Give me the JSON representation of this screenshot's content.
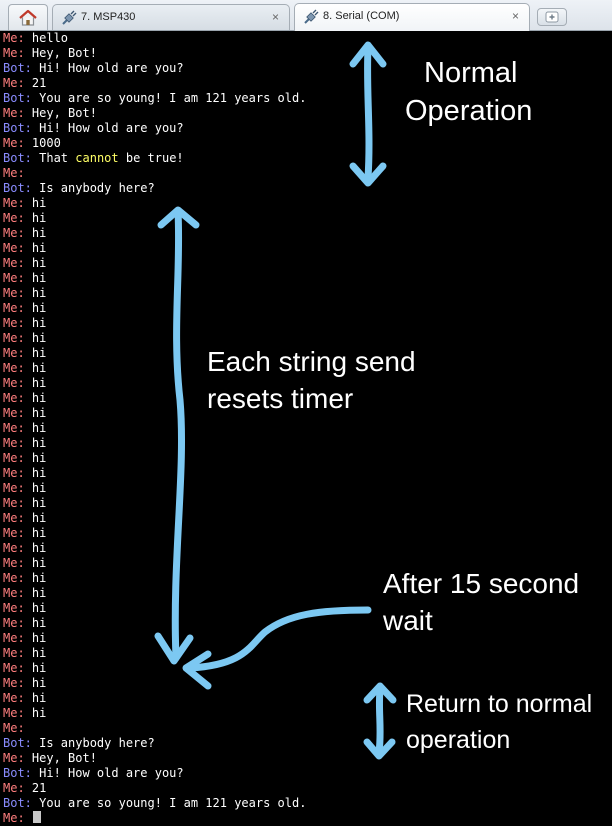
{
  "tabs": {
    "home_icon": "home-icon",
    "items": [
      {
        "label": "7. MSP430",
        "icon": "plug-icon",
        "close": "×",
        "active": false
      },
      {
        "label": "8. Serial (COM)",
        "icon": "plug-icon",
        "close": "×",
        "active": true
      }
    ],
    "new_tab_icon": "new-tab-icon"
  },
  "terminal": {
    "colors": {
      "background": "#000000",
      "me": "#ff7f7f",
      "bot": "#8a8cff",
      "text": "#ffffff",
      "highlight": "#ffff66"
    },
    "lines": [
      {
        "speaker": "Me:",
        "text": " hello"
      },
      {
        "speaker": "Me:",
        "text": " Hey, Bot!"
      },
      {
        "speaker": "Bot:",
        "text": " Hi! How old are you?"
      },
      {
        "speaker": "Me:",
        "text": " 21"
      },
      {
        "speaker": "Bot:",
        "text": " You are so young! I am 121 years old."
      },
      {
        "speaker": "Me:",
        "text": " Hey, Bot!"
      },
      {
        "speaker": "Bot:",
        "text": " Hi! How old are you?"
      },
      {
        "speaker": "Me:",
        "text": " 1000"
      },
      {
        "speaker": "Bot:",
        "text": " That ",
        "highlight": "cannot",
        "after": " be true!"
      },
      {
        "speaker": "Me:",
        "text": ""
      },
      {
        "speaker": "Bot:",
        "text": " Is anybody here?"
      },
      {
        "speaker": "Me:",
        "text": " hi"
      },
      {
        "speaker": "Me:",
        "text": " hi"
      },
      {
        "speaker": "Me:",
        "text": " hi"
      },
      {
        "speaker": "Me:",
        "text": " hi"
      },
      {
        "speaker": "Me:",
        "text": " hi"
      },
      {
        "speaker": "Me:",
        "text": " hi"
      },
      {
        "speaker": "Me:",
        "text": " hi"
      },
      {
        "speaker": "Me:",
        "text": " hi"
      },
      {
        "speaker": "Me:",
        "text": " hi"
      },
      {
        "speaker": "Me:",
        "text": " hi"
      },
      {
        "speaker": "Me:",
        "text": " hi"
      },
      {
        "speaker": "Me:",
        "text": " hi"
      },
      {
        "speaker": "Me:",
        "text": " hi"
      },
      {
        "speaker": "Me:",
        "text": " hi"
      },
      {
        "speaker": "Me:",
        "text": " hi"
      },
      {
        "speaker": "Me:",
        "text": " hi"
      },
      {
        "speaker": "Me:",
        "text": " hi"
      },
      {
        "speaker": "Me:",
        "text": " hi"
      },
      {
        "speaker": "Me:",
        "text": " hi"
      },
      {
        "speaker": "Me:",
        "text": " hi"
      },
      {
        "speaker": "Me:",
        "text": " hi"
      },
      {
        "speaker": "Me:",
        "text": " hi"
      },
      {
        "speaker": "Me:",
        "text": " hi"
      },
      {
        "speaker": "Me:",
        "text": " hi"
      },
      {
        "speaker": "Me:",
        "text": " hi"
      },
      {
        "speaker": "Me:",
        "text": " hi"
      },
      {
        "speaker": "Me:",
        "text": " hi"
      },
      {
        "speaker": "Me:",
        "text": " hi"
      },
      {
        "speaker": "Me:",
        "text": " hi"
      },
      {
        "speaker": "Me:",
        "text": " hi"
      },
      {
        "speaker": "Me:",
        "text": " hi"
      },
      {
        "speaker": "Me:",
        "text": " hi"
      },
      {
        "speaker": "Me:",
        "text": " hi"
      },
      {
        "speaker": "Me:",
        "text": " hi"
      },
      {
        "speaker": "Me:",
        "text": " hi"
      },
      {
        "speaker": "Me:",
        "text": ""
      },
      {
        "speaker": "Bot:",
        "text": " Is anybody here?"
      },
      {
        "speaker": "Me:",
        "text": " Hey, Bot!"
      },
      {
        "speaker": "Bot:",
        "text": " Hi! How old are you?"
      },
      {
        "speaker": "Me:",
        "text": " 21"
      },
      {
        "speaker": "Bot:",
        "text": " You are so young! I am 121 years old."
      },
      {
        "speaker": "Me:",
        "text": "",
        "cursor": true
      }
    ]
  },
  "annotations": {
    "color": "#7cc8f2",
    "items": [
      {
        "name": "annotation-normal-operation",
        "lines": [
          "Normal",
          "Operation"
        ]
      },
      {
        "name": "annotation-each-string-send",
        "lines": [
          "Each string send",
          "resets timer"
        ]
      },
      {
        "name": "annotation-after-15-second-wait",
        "lines": [
          "After 15 second",
          "wait"
        ]
      },
      {
        "name": "annotation-return-to-normal",
        "lines": [
          "Return to normal",
          "operation"
        ]
      }
    ]
  }
}
